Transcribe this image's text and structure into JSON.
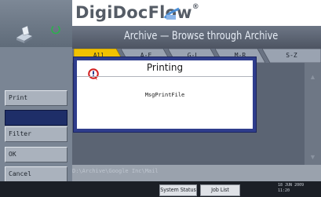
{
  "brand": {
    "name": "DigiDocFlow",
    "reg": "®"
  },
  "header": {
    "title": "Archive — Browse through Archive"
  },
  "tabs": [
    "All",
    "A-F",
    "G-L",
    "M-R",
    "S-Z"
  ],
  "left_buttons": {
    "print": "Print",
    "filter": "Filter",
    "ok": "OK",
    "cancel": "Cancel"
  },
  "path": "D:\\Archive\\Google Inc\\Mail",
  "dialog": {
    "title": "Printing",
    "message": "MsgPrintFile"
  },
  "status_bar": {
    "system_status": "System Status",
    "job_list": "Job List",
    "date": "18 JUN 2009",
    "time": "11:20"
  },
  "colors": {
    "dialog_frame": "#2f3d8c",
    "alert_red": "#d21f1f",
    "power_green": "#2bb24c"
  },
  "icons": {
    "logo": "scanner-icon",
    "power": "power-icon",
    "alert": "alert-icon"
  }
}
